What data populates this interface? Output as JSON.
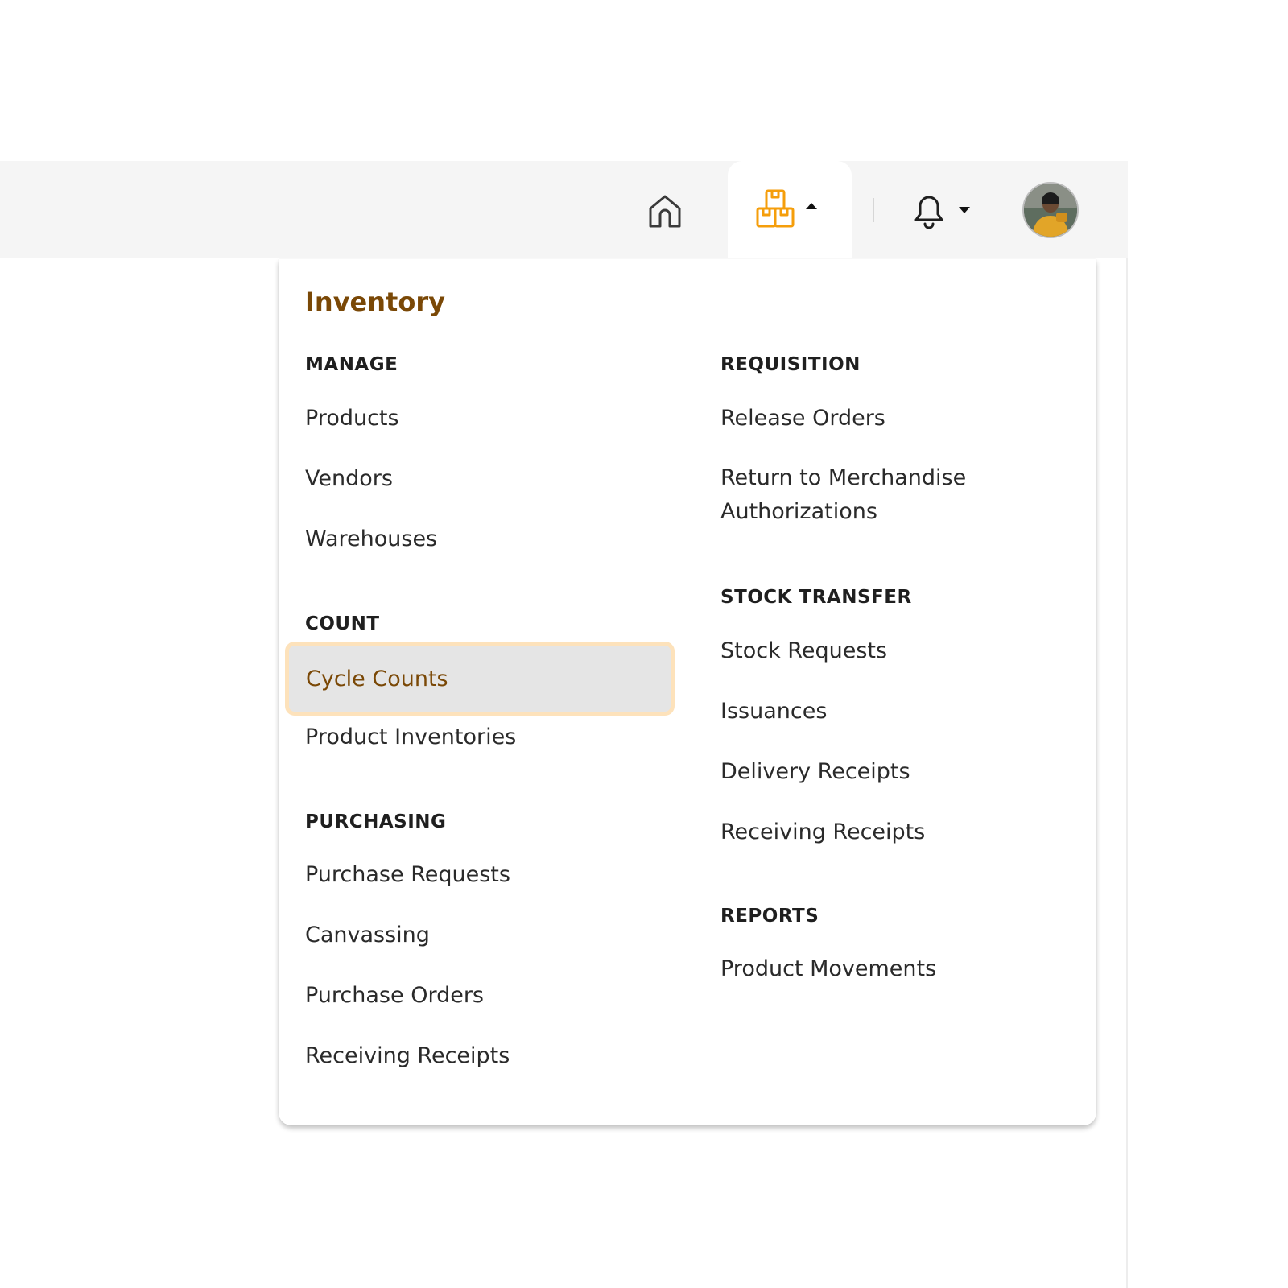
{
  "navbar": {
    "icons": {
      "home": "home-icon",
      "inventory": "boxes-icon",
      "notifications": "bell-icon",
      "caret_up": "caret-up-icon",
      "caret_down": "caret-down-icon"
    },
    "accent_color": "#F59E0B"
  },
  "menu": {
    "title": "Inventory",
    "title_color": "#7A4806",
    "sections": {
      "manage": {
        "heading": "MANAGE",
        "items": [
          "Products",
          "Vendors",
          "Warehouses"
        ]
      },
      "count": {
        "heading": "COUNT",
        "items": [
          "Cycle Counts",
          "Product Inventories"
        ],
        "active_item": "Cycle Counts"
      },
      "purchasing": {
        "heading": "PURCHASING",
        "items": [
          "Purchase Requests",
          "Canvassing",
          "Purchase Orders",
          "Receiving Receipts"
        ]
      },
      "requisition": {
        "heading": "REQUISITION",
        "items": [
          "Release Orders",
          "Return to Merchandise Authorizations"
        ]
      },
      "stock_transfer": {
        "heading": "STOCK TRANSFER",
        "items": [
          "Stock Requests",
          "Issuances",
          "Delivery Receipts",
          "Receiving Receipts"
        ]
      },
      "reports": {
        "heading": "REPORTS",
        "items": [
          "Product Movements"
        ]
      }
    }
  }
}
